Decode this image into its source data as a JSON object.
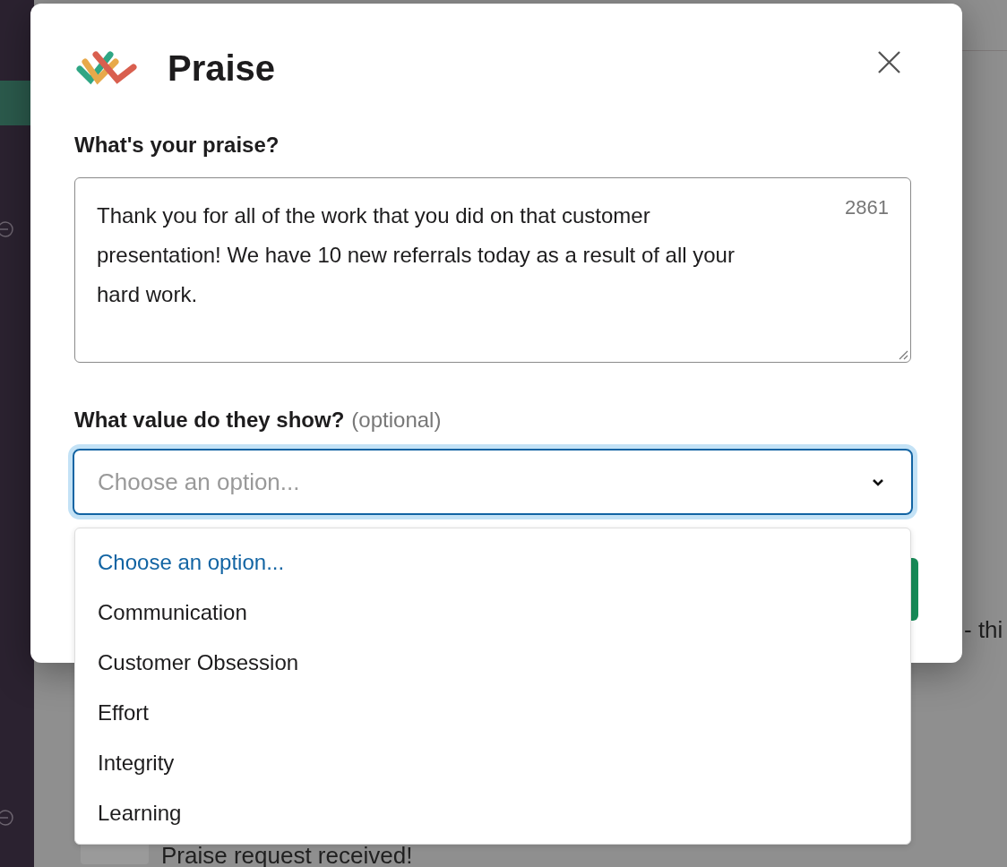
{
  "background": {
    "side_text": "- thi",
    "message": "Praise request received!"
  },
  "dialog": {
    "title": "Praise",
    "praise_field": {
      "label": "What's your praise?",
      "value": "Thank you for all of the work that you did on that customer presentation! We have 10 new referrals today as a result of all your hard work.",
      "counter": "2861"
    },
    "value_field": {
      "label": "What value do they show?",
      "hint": "(optional)",
      "placeholder": "Choose an option...",
      "expanded": true,
      "options": [
        {
          "label": "Choose an option...",
          "selected": true
        },
        {
          "label": "Communication",
          "selected": false
        },
        {
          "label": "Customer Obsession",
          "selected": false
        },
        {
          "label": "Effort",
          "selected": false
        },
        {
          "label": "Integrity",
          "selected": false
        },
        {
          "label": "Learning",
          "selected": false
        }
      ]
    }
  }
}
